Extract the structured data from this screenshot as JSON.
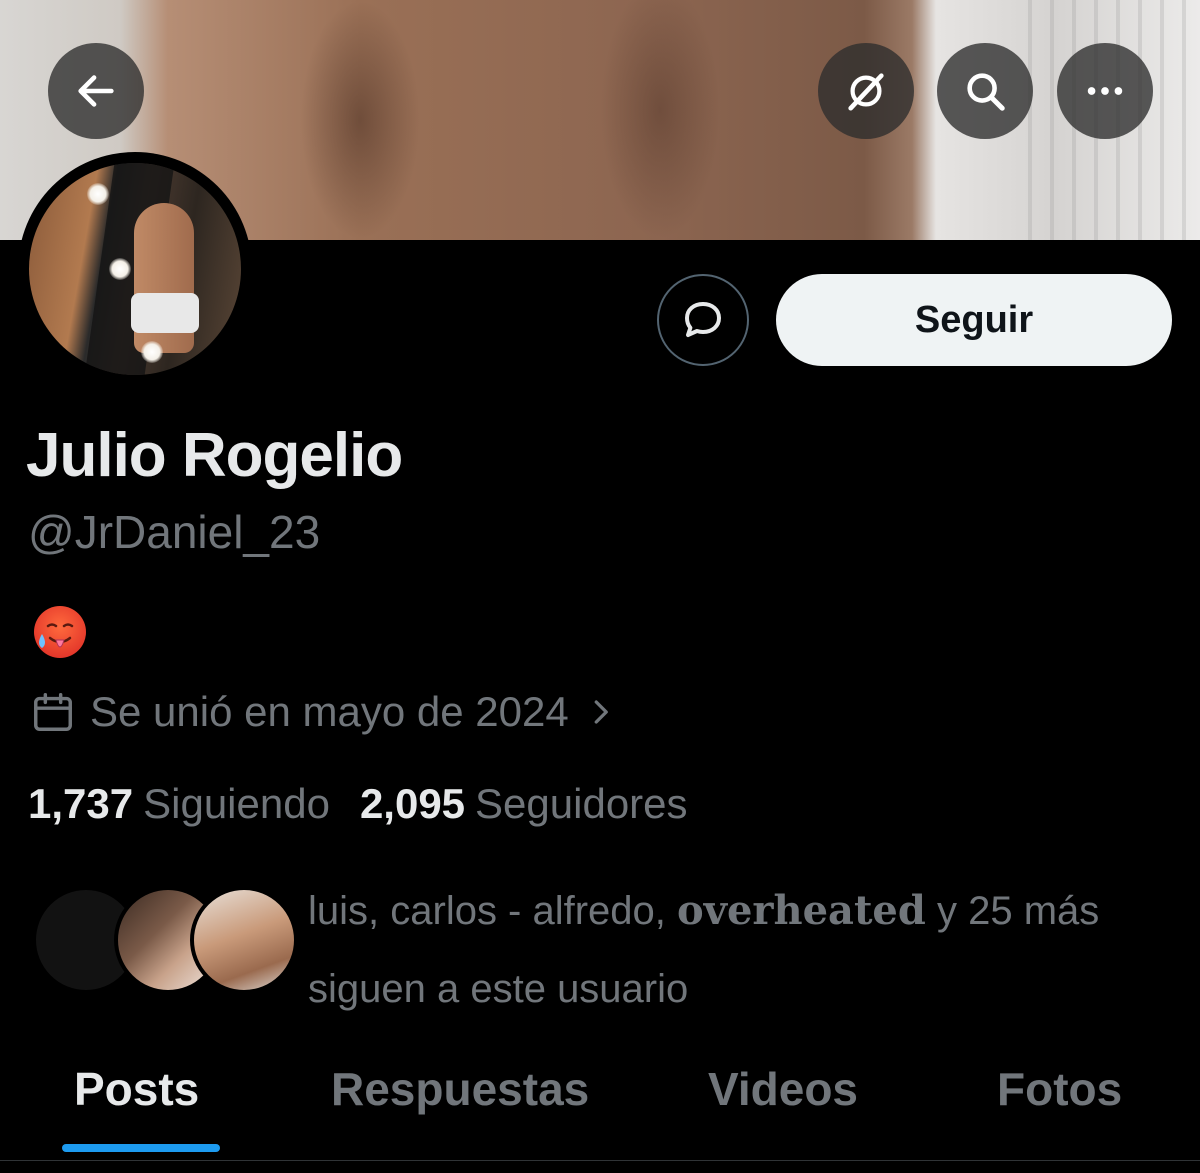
{
  "header": {
    "back_icon": "arrow-left-icon",
    "grok_icon": "grok-slash-icon",
    "search_icon": "search-icon",
    "more_icon": "more-horizontal-icon"
  },
  "profile": {
    "display_name": "Julio Rogelio",
    "handle": "@JrDaniel_23",
    "bio_emoji": "🥵",
    "joined": "Se unió en mayo de 2024",
    "following_count": "1,737",
    "following_label": "Siguiendo",
    "followers_count": "2,095",
    "followers_label": "Seguidores"
  },
  "actions": {
    "message_icon": "message-bubble-icon",
    "follow_label": "Seguir"
  },
  "known_followers": {
    "names_prefix": "luis, carlos - alfredo,",
    "highlighted": "overheated",
    "suffix": "y 25 más",
    "line2": "siguen a este usuario"
  },
  "tabs": [
    {
      "label": "Posts",
      "active": true
    },
    {
      "label": "Respuestas",
      "active": false
    },
    {
      "label": "Videos",
      "active": false
    },
    {
      "label": "Fotos",
      "active": false
    }
  ],
  "colors": {
    "background": "#000000",
    "text_primary": "#e7e9ea",
    "text_secondary": "#71767b",
    "accent": "#1d9bf0",
    "follow_button_bg": "#eff3f4"
  }
}
